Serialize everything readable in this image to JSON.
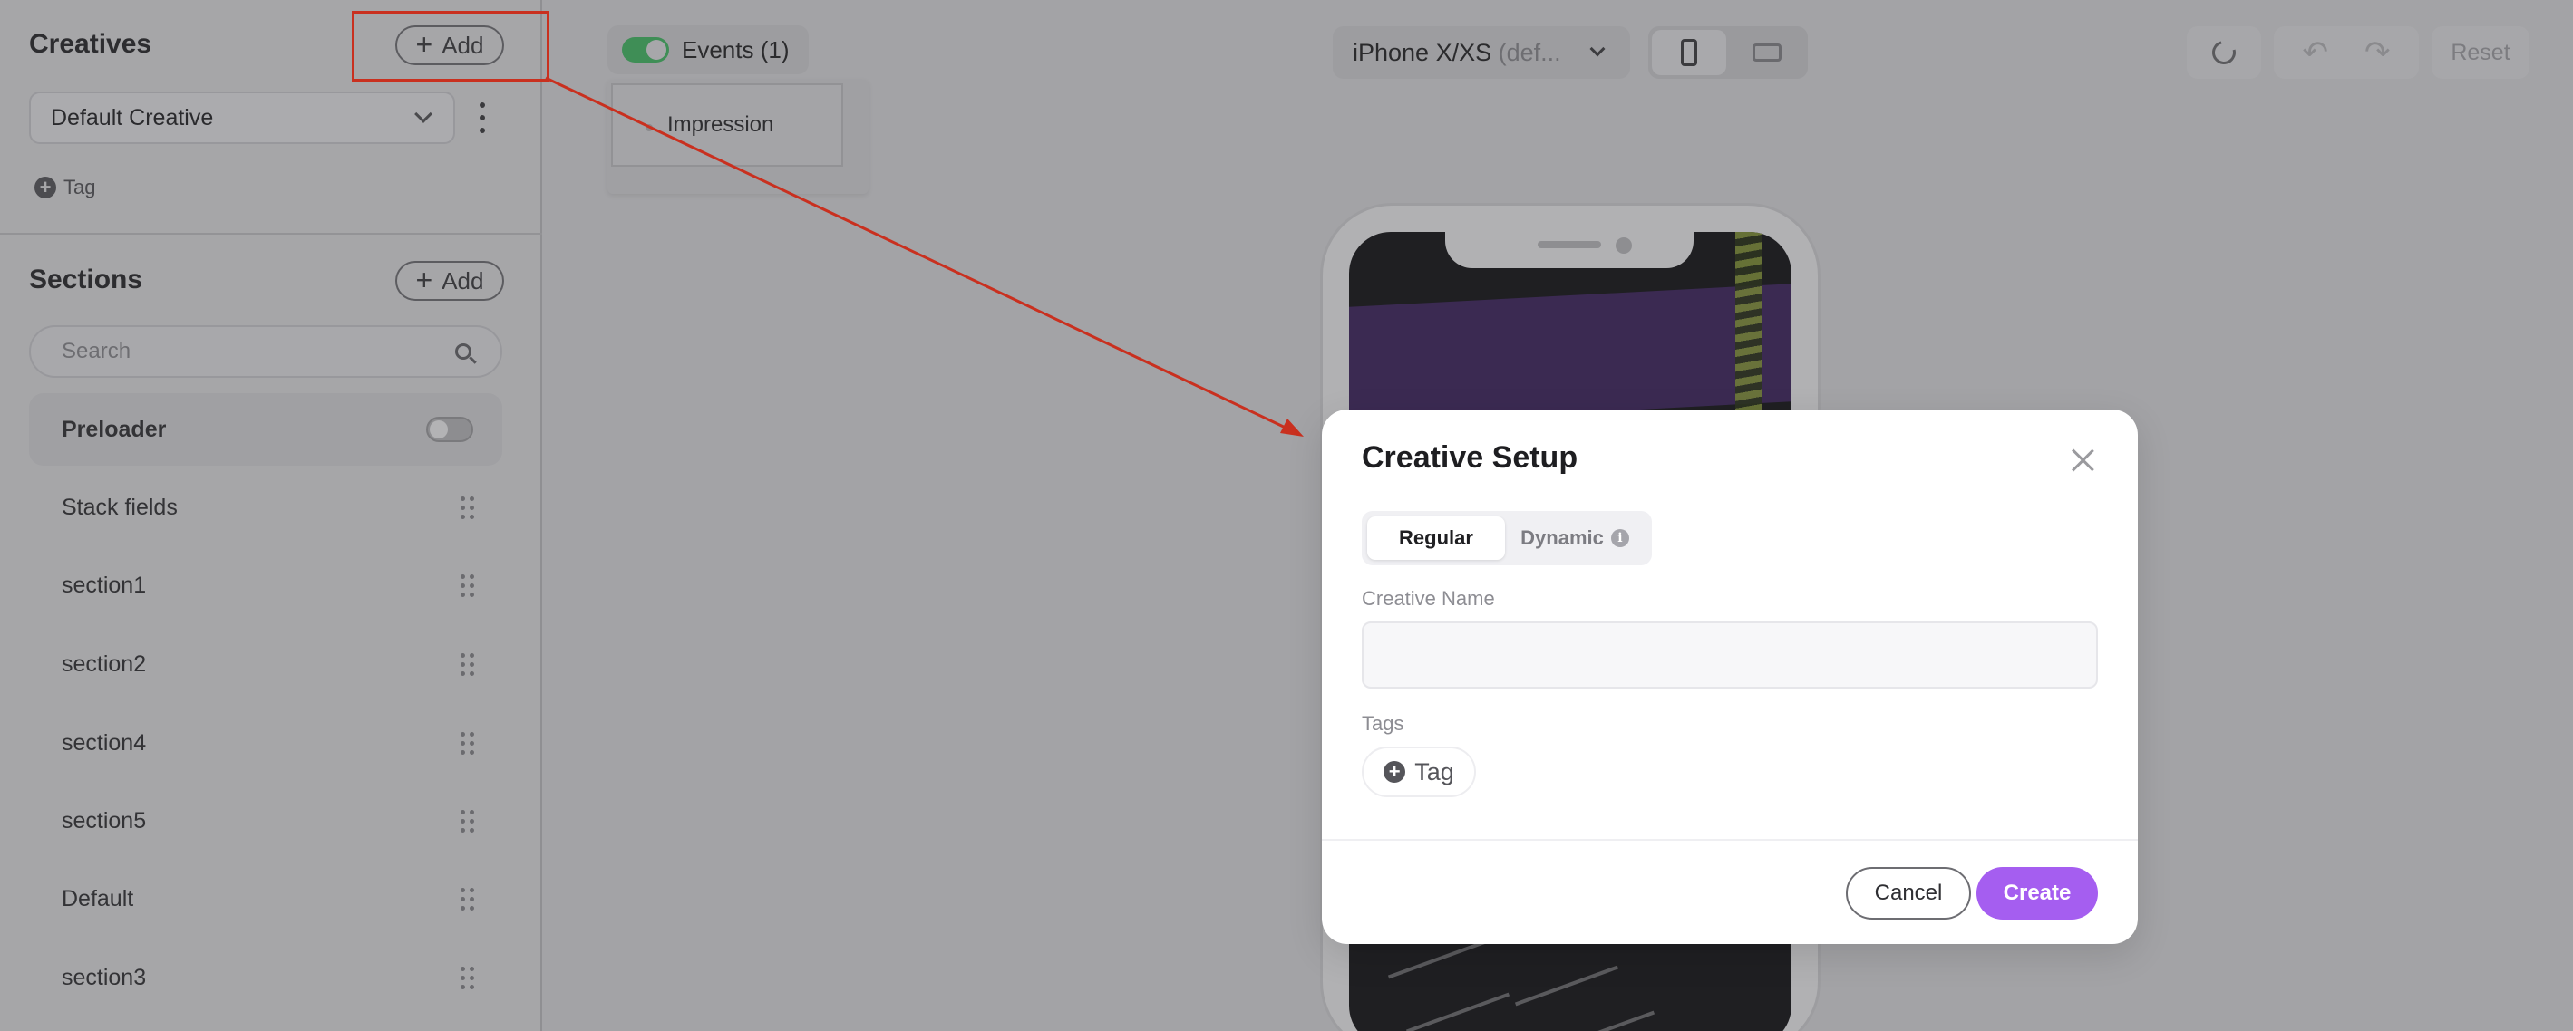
{
  "sidebar": {
    "creatives_title": "Creatives",
    "add_label": "Add",
    "selected_creative": "Default Creative",
    "tag_label": "Tag",
    "sections_title": "Sections",
    "sections_add_label": "Add",
    "search_placeholder": "Search",
    "sections": [
      {
        "label": "Preloader",
        "control": "toggle-off"
      },
      {
        "label": "Stack fields",
        "control": "drag-handle-icon"
      },
      {
        "label": "section1",
        "control": "drag-handle-icon"
      },
      {
        "label": "section2",
        "control": "drag-handle-icon"
      },
      {
        "label": "section4",
        "control": "drag-handle-icon"
      },
      {
        "label": "section5",
        "control": "drag-handle-icon"
      },
      {
        "label": "Default",
        "control": "drag-handle-icon"
      },
      {
        "label": "section3",
        "control": "drag-handle-icon"
      }
    ]
  },
  "toolbar": {
    "events_label": "Events (1)",
    "events_enabled": true,
    "events": [
      "Impression"
    ],
    "device_name": "iPhone X/XS",
    "device_suffix": "(def...",
    "orientation_active": "portrait",
    "reset_label": "Reset"
  },
  "modal": {
    "title": "Creative Setup",
    "tabs": [
      {
        "label": "Regular",
        "active": true
      },
      {
        "label": "Dynamic",
        "active": false,
        "icon": "info-icon"
      }
    ],
    "name_label": "Creative Name",
    "name_value": "",
    "tags_label": "Tags",
    "tag_button": "Tag",
    "cancel_label": "Cancel",
    "create_label": "Create"
  },
  "colors": {
    "accent": "#a55ef0",
    "annotation": "#c9301f",
    "toggle_on": "#3f8e56"
  }
}
